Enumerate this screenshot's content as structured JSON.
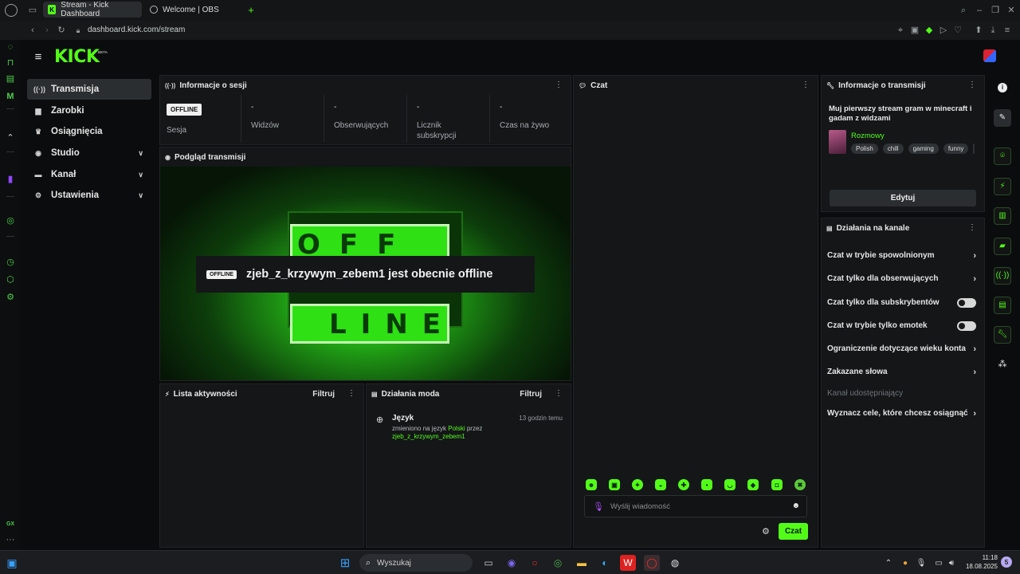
{
  "browser": {
    "tabs": [
      {
        "label": "Stream - Kick Dashboard",
        "active": true
      },
      {
        "label": "Welcome | OBS",
        "active": false
      }
    ],
    "new_tab": "+",
    "url": "dashboard.kick.com/stream"
  },
  "app": {
    "logo": "KICK",
    "logo_sup": "BETA"
  },
  "nav": {
    "items": [
      {
        "label": "Transmisja",
        "icon": "broadcast-icon",
        "active": true
      },
      {
        "label": "Zarobki",
        "icon": "money-icon"
      },
      {
        "label": "Osiągnięcia",
        "icon": "trophy-icon"
      },
      {
        "label": "Studio",
        "icon": "studio-icon",
        "expandable": true
      },
      {
        "label": "Kanał",
        "icon": "channel-icon",
        "expandable": true
      },
      {
        "label": "Ustawienia",
        "icon": "gear-icon",
        "expandable": true
      }
    ]
  },
  "session": {
    "title": "Informacje o sesji",
    "status_badge": "OFFLINE",
    "stats": [
      {
        "label": "Sesja"
      },
      {
        "value": "-",
        "label": "Widzów"
      },
      {
        "value": "-",
        "label": "Obserwujących"
      },
      {
        "value": "-",
        "label": "Licznik subskrypcji"
      },
      {
        "value": "-",
        "label": "Czas na żywo"
      }
    ]
  },
  "preview": {
    "title": "Podgląd transmisji",
    "offline_badge": "OFFLINE",
    "message": "zjeb_z_krzywym_zebem1 jest obecnie offline",
    "sign_top": "OFF",
    "sign_bottom": "LINE"
  },
  "activity": {
    "title": "Lista aktywności",
    "filter": "Filtruj"
  },
  "modactions": {
    "title": "Działania moda",
    "filter": "Filtruj",
    "items": [
      {
        "title": "Język",
        "time": "13 godzin temu",
        "text_a": "zmieniono na język ",
        "lang": "Polski",
        "text_b": " przez ",
        "user": "zjeb_z_krzywym_zebem1"
      }
    ]
  },
  "chat": {
    "title": "Czat",
    "placeholder": "Wyślij wiadomość",
    "send": "Czat"
  },
  "streaminfo": {
    "title": "Informacje o transmisji",
    "stream_title": "Muj pierwszy stream gram w minecraft i gadam z widzami",
    "category": "Rozmowy",
    "tags": [
      "Polish",
      "chill",
      "gaming",
      "funny"
    ],
    "edit": "Edytuj"
  },
  "channelactions": {
    "title": "Działania na kanale",
    "items": [
      {
        "label": "Czat w trybie spowolnionym",
        "control": "arrow"
      },
      {
        "label": "Czat tylko dla obserwujących",
        "control": "arrow"
      },
      {
        "label": "Czat tylko dla subskrybentów",
        "control": "toggle"
      },
      {
        "label": "Czat w trybie tylko emotek",
        "control": "toggle"
      },
      {
        "label": "Ograniczenie dotyczące wieku konta",
        "control": "arrow"
      },
      {
        "label": "Zakazane słowa",
        "control": "arrow"
      },
      {
        "label": "Kanał udostępniający",
        "control": "none"
      },
      {
        "label": "Wyznacz cele, które chcesz osiągnąć",
        "control": "arrow"
      }
    ]
  },
  "taskbar": {
    "search": "Wyszukaj",
    "time": "11:18",
    "date": "18.08.2025",
    "notif_count": "5"
  },
  "colors": {
    "accent": "#53fc18",
    "bg": "#0b0c0d",
    "panel": "#141618"
  }
}
